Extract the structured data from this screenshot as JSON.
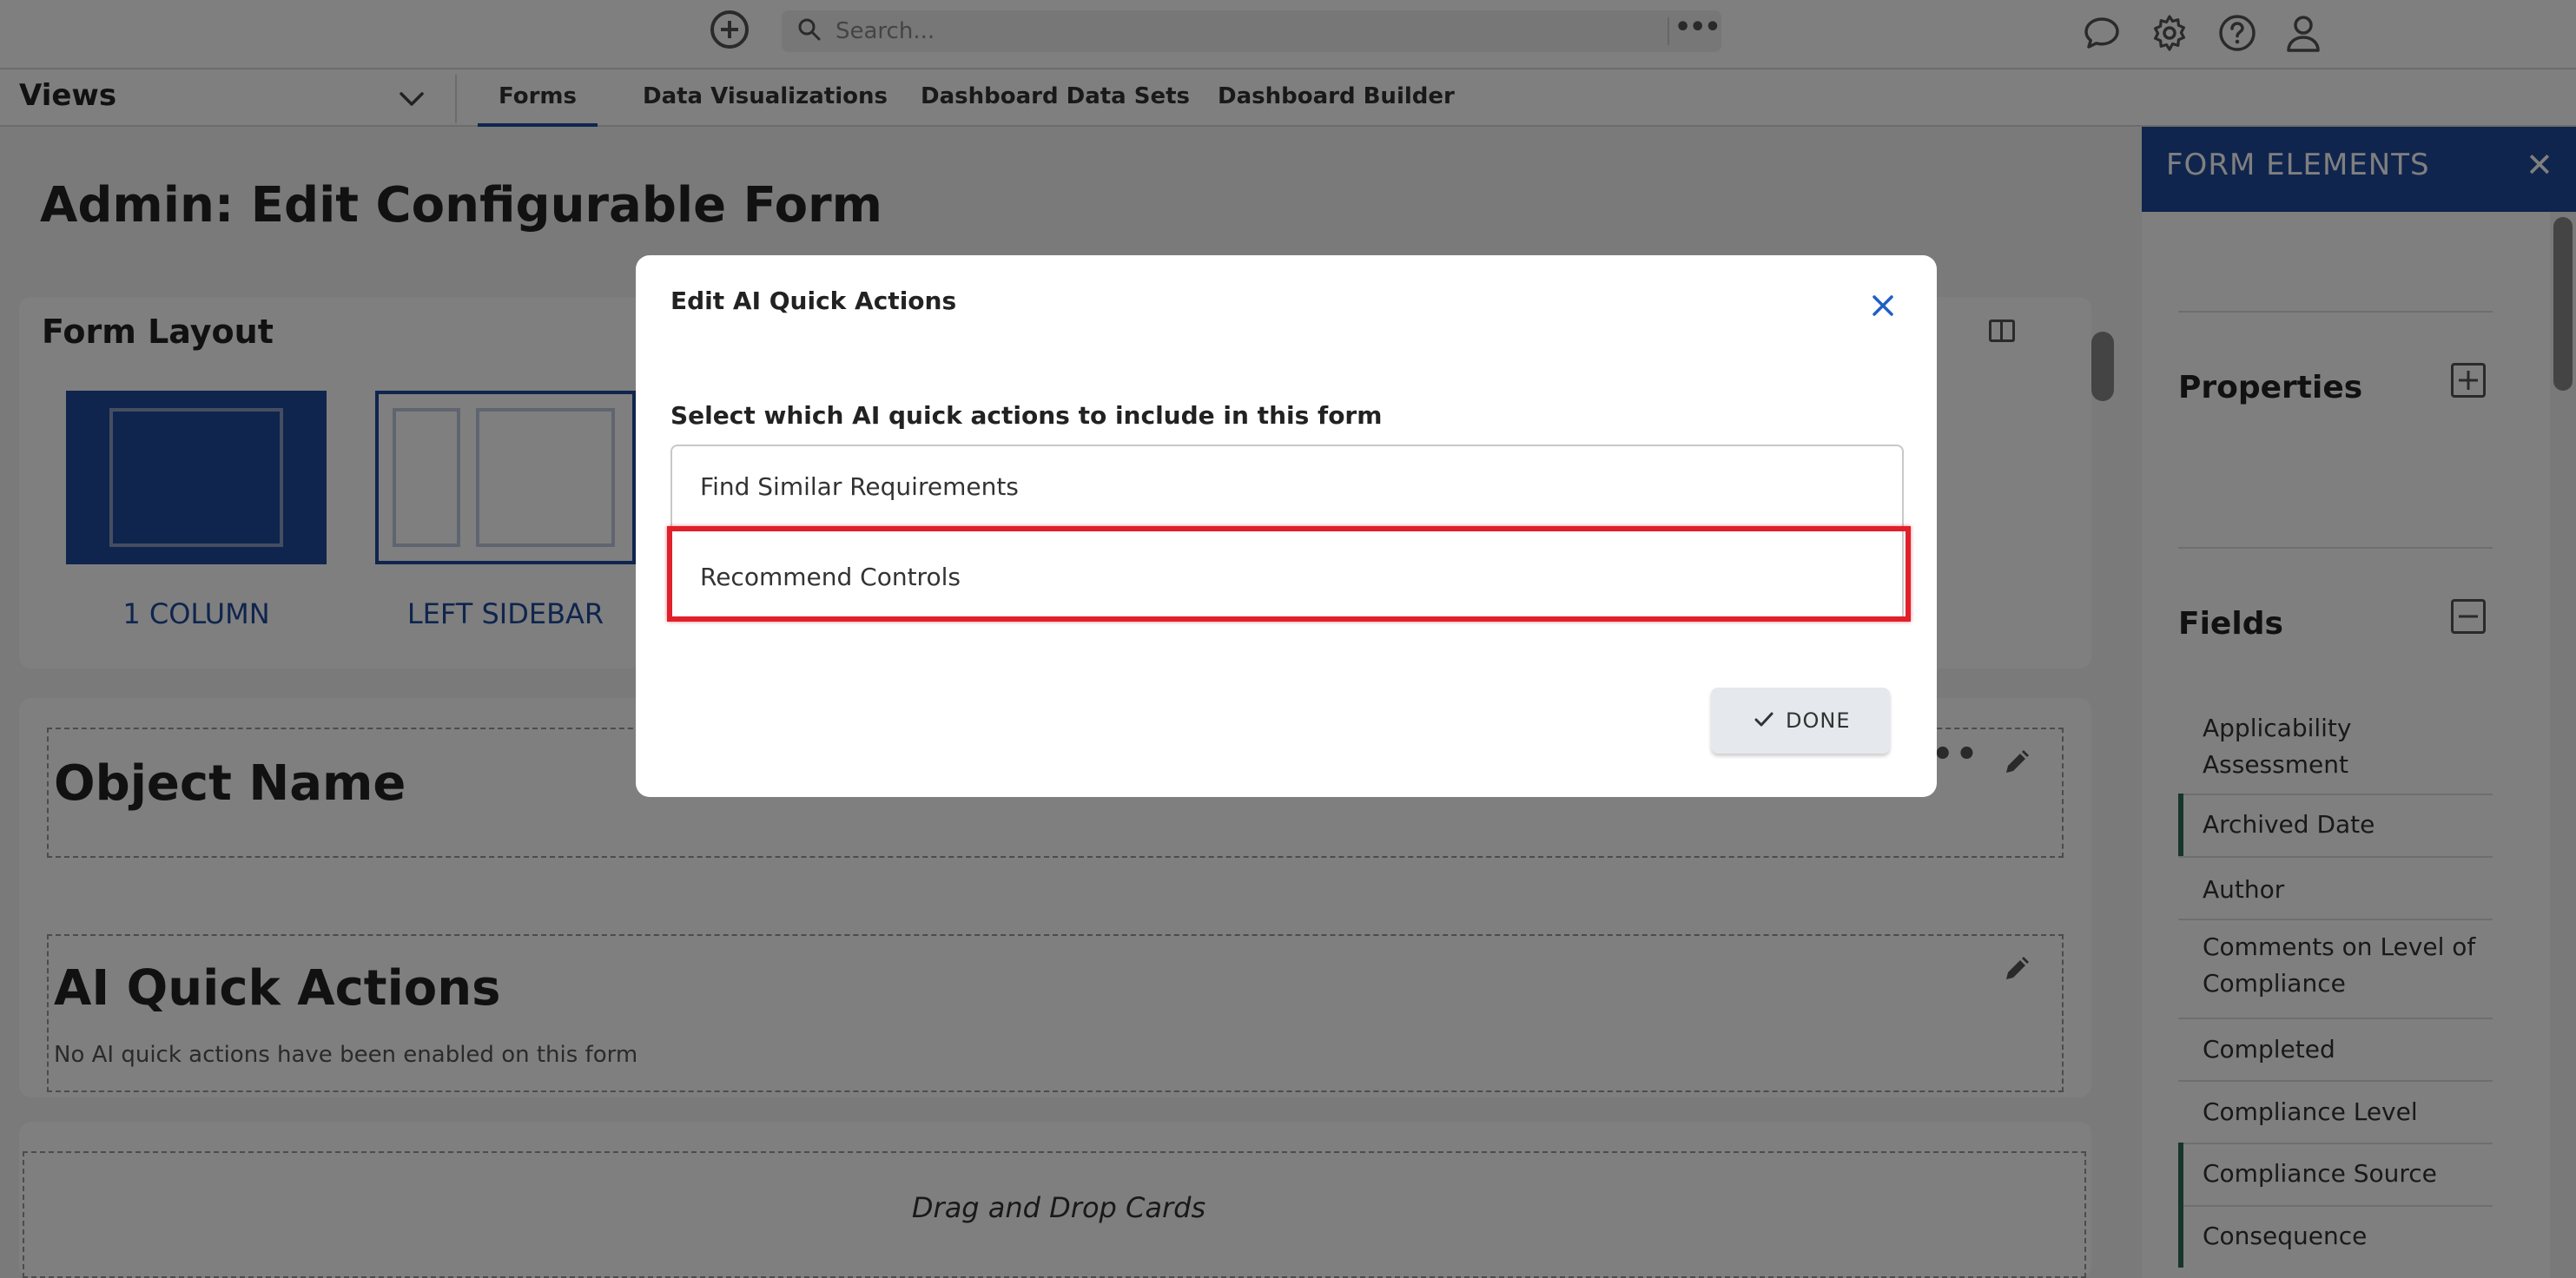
{
  "search": {
    "placeholder": "Search..."
  },
  "views": {
    "label": "Views"
  },
  "tabs": [
    {
      "label": "Forms"
    },
    {
      "label": "Data Visualizations"
    },
    {
      "label": "Dashboard Data Sets"
    },
    {
      "label": "Dashboard Builder"
    }
  ],
  "page": {
    "title": "Admin: Edit Configurable Form"
  },
  "form_layout": {
    "title": "Form Layout",
    "options": [
      {
        "label": "1 COLUMN"
      },
      {
        "label": "LEFT SIDEBAR"
      }
    ]
  },
  "cards": {
    "object_name": "Object Name",
    "ai_quick_actions": "AI Quick Actions",
    "ai_empty": "No AI quick actions have been enabled on this form",
    "drag_drop": "Drag and Drop Cards"
  },
  "form_elements": {
    "title": "FORM ELEMENTS",
    "close": "✕",
    "properties": "Properties",
    "fields_title": "Fields",
    "fields": [
      {
        "label": "Applicability Assessment"
      },
      {
        "label": "Archived Date"
      },
      {
        "label": "Author"
      },
      {
        "label": "Comments on Level of Compliance"
      },
      {
        "label": "Completed"
      },
      {
        "label": "Compliance Level"
      },
      {
        "label": "Compliance Source"
      },
      {
        "label": "Consequence"
      }
    ]
  },
  "modal": {
    "title": "Edit AI Quick Actions",
    "subtitle": "Select which AI quick actions to include in this form",
    "options": [
      {
        "label": "Find Similar Requirements"
      },
      {
        "label": "Recommend Controls"
      }
    ],
    "done_label": "DONE"
  },
  "colors": {
    "brand": "#1f4b9c",
    "highlight": "#e0202a",
    "field_marker": "#2f6a55"
  },
  "icons": {
    "add": "add-circle-icon",
    "search": "search-icon",
    "more": "more-horizontal-icon",
    "chat": "chat-bubble-icon",
    "settings": "gear-icon",
    "help": "help-circle-icon",
    "user": "user-icon"
  }
}
